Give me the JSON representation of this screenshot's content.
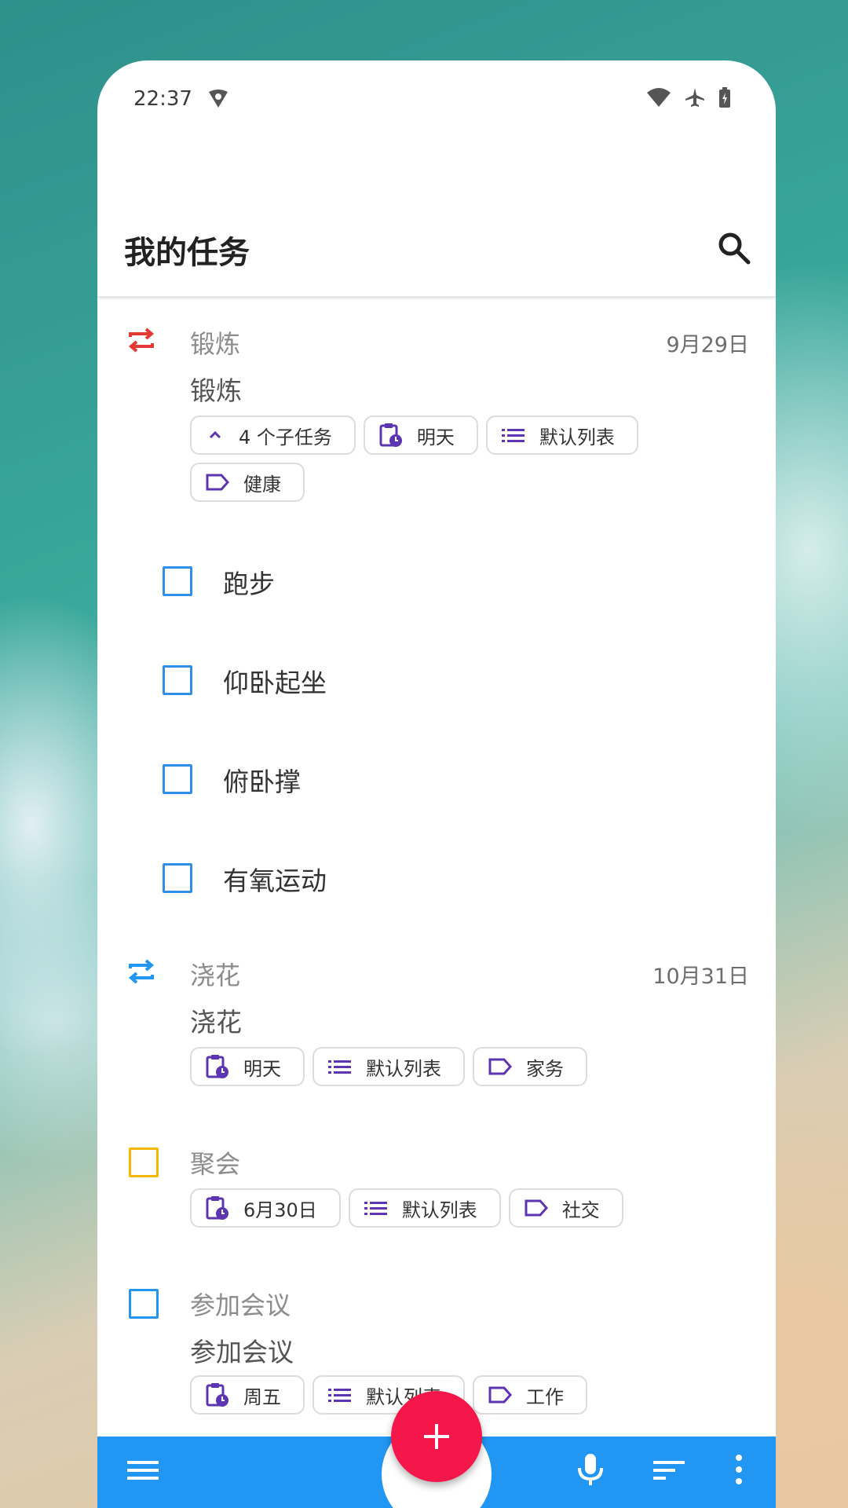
{
  "status_bar": {
    "time": "22:37"
  },
  "app_bar": {
    "title": "我的任务"
  },
  "tasks": [
    {
      "icon": "repeat-icon",
      "icon_color": "#e53935",
      "small_title": "锻炼",
      "date": "9月29日",
      "body": "锻炼",
      "chips": [
        {
          "icon": "chevron-up-icon",
          "label": "4 个子任务"
        },
        {
          "icon": "clipboard-clock-icon",
          "label": "明天"
        },
        {
          "icon": "list-icon",
          "label": "默认列表"
        },
        {
          "icon": "tag-icon",
          "label": "健康"
        }
      ],
      "subtasks": [
        "跑步",
        "仰卧起坐",
        "俯卧撑",
        "有氧运动"
      ]
    },
    {
      "icon": "repeat-icon",
      "icon_color": "#2196f3",
      "small_title": "浇花",
      "date": "10月31日",
      "body": "浇花",
      "chips": [
        {
          "icon": "clipboard-clock-icon",
          "label": "明天"
        },
        {
          "icon": "list-icon",
          "label": "默认列表"
        },
        {
          "icon": "tag-icon",
          "label": "家务"
        }
      ]
    },
    {
      "icon": "checkbox-icon",
      "icon_color": "#f5b800",
      "small_title": "聚会",
      "chips": [
        {
          "icon": "clipboard-clock-icon",
          "label": "6月30日"
        },
        {
          "icon": "list-icon",
          "label": "默认列表"
        },
        {
          "icon": "tag-icon",
          "label": "社交"
        }
      ]
    },
    {
      "icon": "checkbox-icon",
      "icon_color": "#2196f3",
      "small_title": "参加会议",
      "body": "参加会议",
      "chips": [
        {
          "icon": "clipboard-clock-icon",
          "label": "周五"
        },
        {
          "icon": "list-icon",
          "label": "默认列表"
        },
        {
          "icon": "tag-icon",
          "label": "工作"
        }
      ]
    }
  ],
  "bottom_bar": {
    "menu_icon": "menu-icon",
    "fab_icon": "plus-icon",
    "mic_icon": "mic-icon",
    "sort_icon": "sort-icon",
    "more_icon": "more-vert-icon"
  },
  "colors": {
    "accent": "#2196f3",
    "fab": "#f5174a",
    "chip_icon": "#5e35b1"
  }
}
